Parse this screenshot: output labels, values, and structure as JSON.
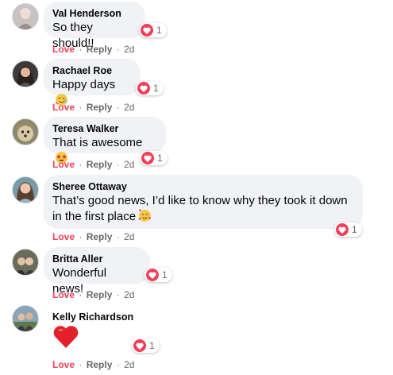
{
  "actions": {
    "love": "Love",
    "reply": "Reply",
    "sep": "·"
  },
  "colors": {
    "love": "#f33e58",
    "bubble": "#f0f2f5",
    "meta": "#65676b"
  },
  "comments": [
    {
      "author": "Val Henderson",
      "text": "So they should!!",
      "reactions": "1",
      "time": "2d",
      "emoji": ""
    },
    {
      "author": "Rachael Roe",
      "text": "Happy days",
      "reactions": "1",
      "time": "2d",
      "emoji": "smiling-face-with-tear-icon"
    },
    {
      "author": "Teresa Walker",
      "text": "That is awesome",
      "reactions": "1",
      "time": "2d",
      "emoji": "star-struck-icon"
    },
    {
      "author": "Sheree Ottaway",
      "text_line1": "That’s good news, I’d like to know why they took it down",
      "text_line2": "in the first place",
      "reactions": "1",
      "time": "2d",
      "emoji": "smiling-face-with-hearts-icon"
    },
    {
      "author": "Britta Aller",
      "text": "Wonderful news!",
      "reactions": "1",
      "time": "2d",
      "emoji": ""
    },
    {
      "author": "Kelly Richardson",
      "text": "",
      "reactions": "1",
      "time": "2d",
      "emoji": "red-heart-icon"
    }
  ]
}
